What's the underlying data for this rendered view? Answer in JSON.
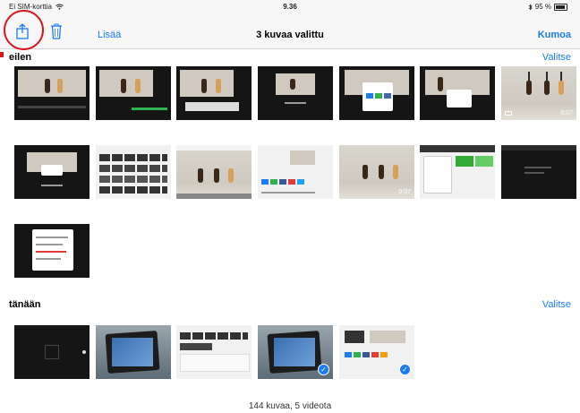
{
  "status_bar": {
    "carrier": "Ei SIM-korttia",
    "time": "9.36",
    "battery": "95 %"
  },
  "toolbar": {
    "add_label": "Lisää",
    "title": "3 kuvaa valittu",
    "cancel_label": "Kumoa"
  },
  "sections": [
    {
      "title": "eilen",
      "select_label": "Valitse"
    },
    {
      "title": "tänään",
      "select_label": "Valitse"
    }
  ],
  "video_durations": [
    "0:07",
    "0:07"
  ],
  "check_mark": "✓",
  "footer": "144 kuvaa, 5 videota",
  "colors": {
    "accent": "#1a7cf0",
    "annotation": "#d71920"
  },
  "icons": [
    "share-icon",
    "trash-icon",
    "wifi-icon",
    "bluetooth-icon",
    "battery-icon",
    "video-camera-icon",
    "checkmark-icon"
  ]
}
